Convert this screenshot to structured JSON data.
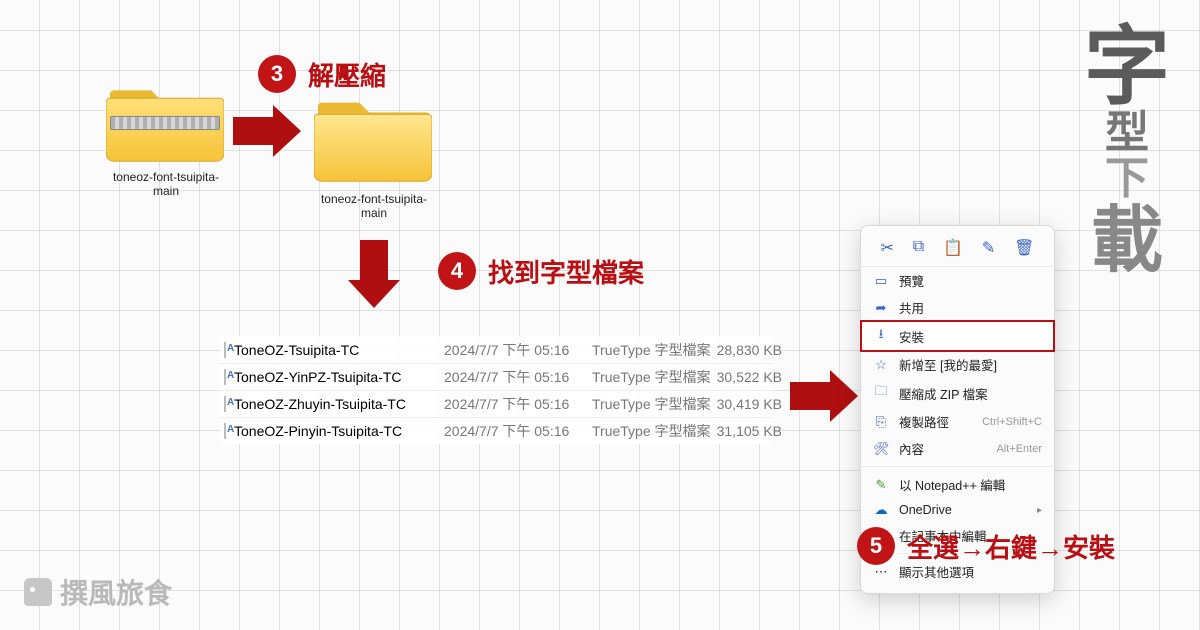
{
  "side_title": {
    "c1": "字",
    "c2": "型",
    "c3": "下",
    "c4": "載"
  },
  "folders": {
    "zip": {
      "label": "toneoz-font-tsuipita-main"
    },
    "plain": {
      "label": "toneoz-font-tsuipita-main"
    }
  },
  "steps": {
    "s3": {
      "num": "3",
      "label": "解壓縮"
    },
    "s4": {
      "num": "4",
      "label": "找到字型檔案"
    },
    "s5": {
      "num": "5",
      "label": "全選→右鍵→安裝"
    }
  },
  "files": [
    {
      "name": "ToneOZ-Tsuipita-TC",
      "date": "2024/7/7 下午 05:16",
      "type": "TrueType 字型檔案",
      "size": "28,830 KB"
    },
    {
      "name": "ToneOZ-YinPZ-Tsuipita-TC",
      "date": "2024/7/7 下午 05:16",
      "type": "TrueType 字型檔案",
      "size": "30,522 KB"
    },
    {
      "name": "ToneOZ-Zhuyin-Tsuipita-TC",
      "date": "2024/7/7 下午 05:16",
      "type": "TrueType 字型檔案",
      "size": "30,419 KB"
    },
    {
      "name": "ToneOZ-Pinyin-Tsuipita-TC",
      "date": "2024/7/7 下午 05:16",
      "type": "TrueType 字型檔案",
      "size": "31,105 KB"
    }
  ],
  "context_menu": {
    "preview": "預覽",
    "share": "共用",
    "install": "安裝",
    "fav": "新增至 [我的最愛]",
    "zip": "壓縮成 ZIP 檔案",
    "copypath": "複製路徑",
    "copypath_hint": "Ctrl+Shift+C",
    "props": "內容",
    "props_hint": "Alt+Enter",
    "npp": "以 Notepad++ 編輯",
    "onedrive": "OneDrive",
    "notepad": "在記事本中編輯",
    "more": "顯示其他選項"
  },
  "watermark": "撰風旅食"
}
